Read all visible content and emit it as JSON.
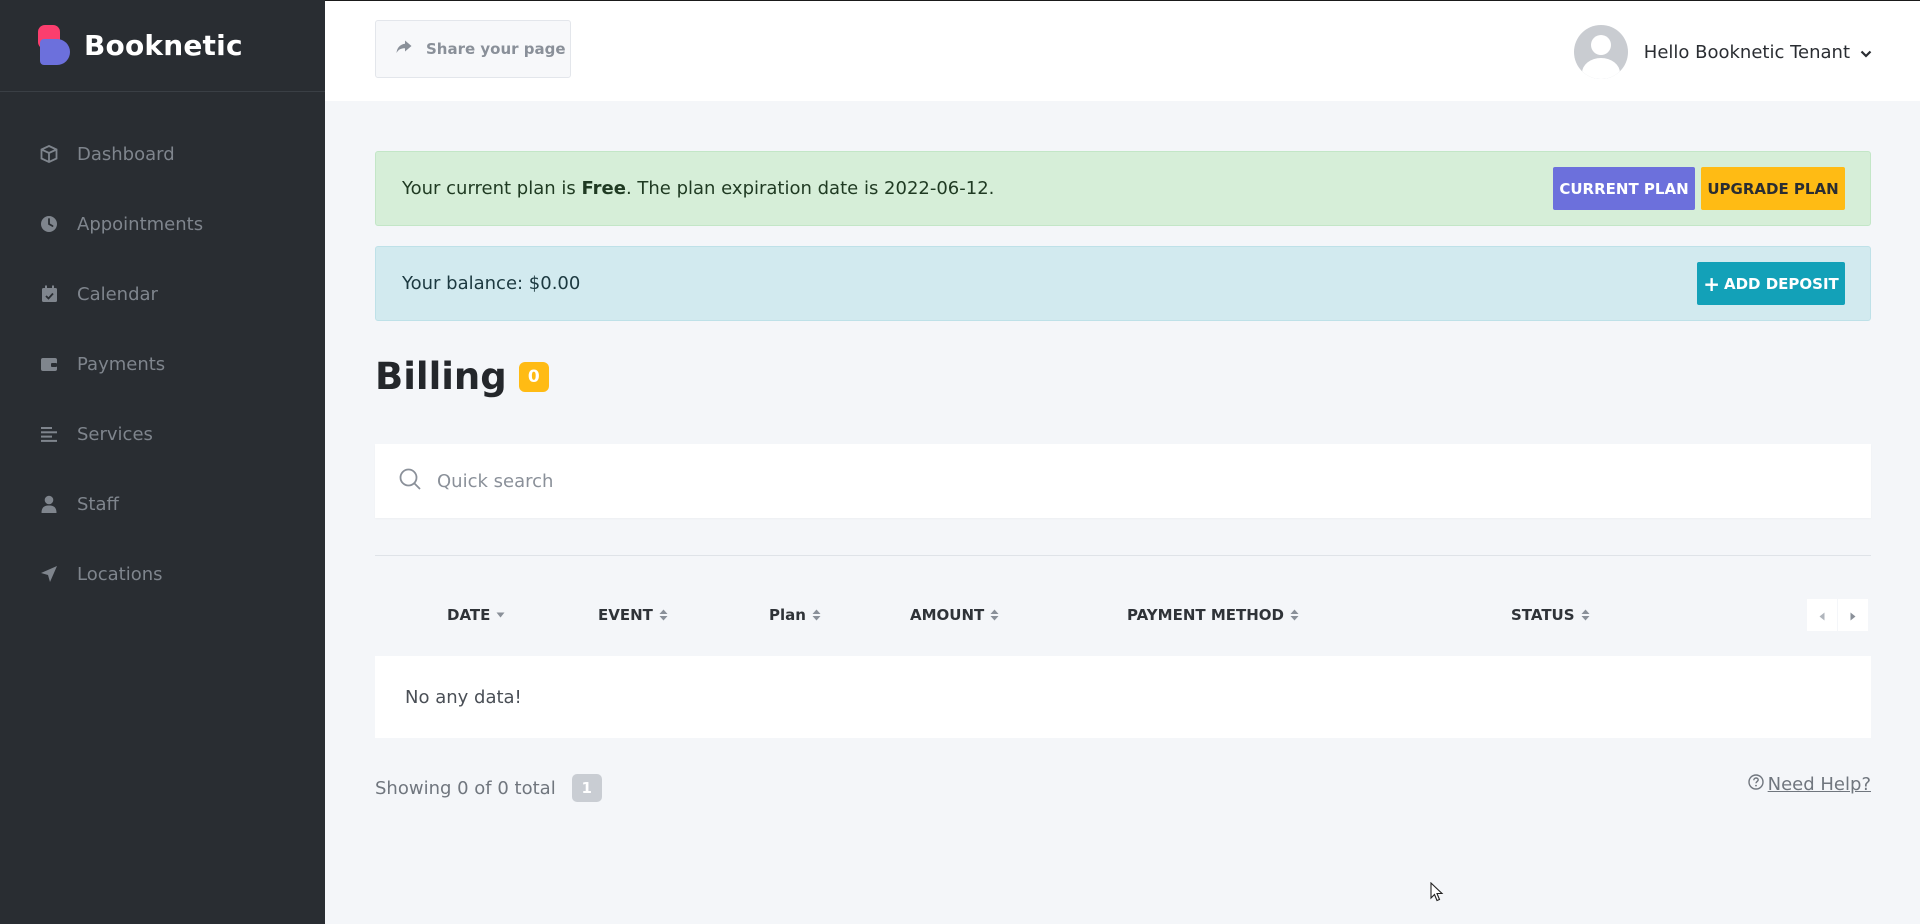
{
  "sidebar": {
    "brand": "Booknetic",
    "items": [
      {
        "label": "Dashboard",
        "icon": "box-icon"
      },
      {
        "label": "Appointments",
        "icon": "clock-icon"
      },
      {
        "label": "Calendar",
        "icon": "calendar-check-icon"
      },
      {
        "label": "Payments",
        "icon": "wallet-icon"
      },
      {
        "label": "Services",
        "icon": "list-icon"
      },
      {
        "label": "Staff",
        "icon": "user-icon"
      },
      {
        "label": "Locations",
        "icon": "location-arrow-icon"
      }
    ]
  },
  "topbar": {
    "share_label": "Share your page",
    "user_greeting": "Hello Booknetic Tenant"
  },
  "plan_alert": {
    "prefix": "Your current plan is ",
    "plan": "Free",
    "suffix": ". The plan expiration date is 2022-06-12.",
    "current_plan_label": "CURRENT PLAN",
    "upgrade_plan_label": "UPGRADE PLAN"
  },
  "balance_alert": {
    "text": "Your balance: $0.00",
    "add_deposit_label": "ADD DEPOSIT"
  },
  "page": {
    "title": "Billing",
    "count": "0"
  },
  "search": {
    "placeholder": "Quick search"
  },
  "table": {
    "columns": [
      "DATE",
      "EVENT",
      "Plan",
      "AMOUNT",
      "PAYMENT METHOD",
      "STATUS"
    ],
    "empty_text": "No any data!"
  },
  "footer": {
    "showing": "Showing 0 of 0 total",
    "page": "1",
    "help": "Need Help?"
  },
  "colors": {
    "sidebar_bg": "#292d32",
    "primary": "#6c70dc",
    "warning": "#ffbb14",
    "info": "#13a1b8",
    "brand_pink": "#fb3e6e"
  }
}
